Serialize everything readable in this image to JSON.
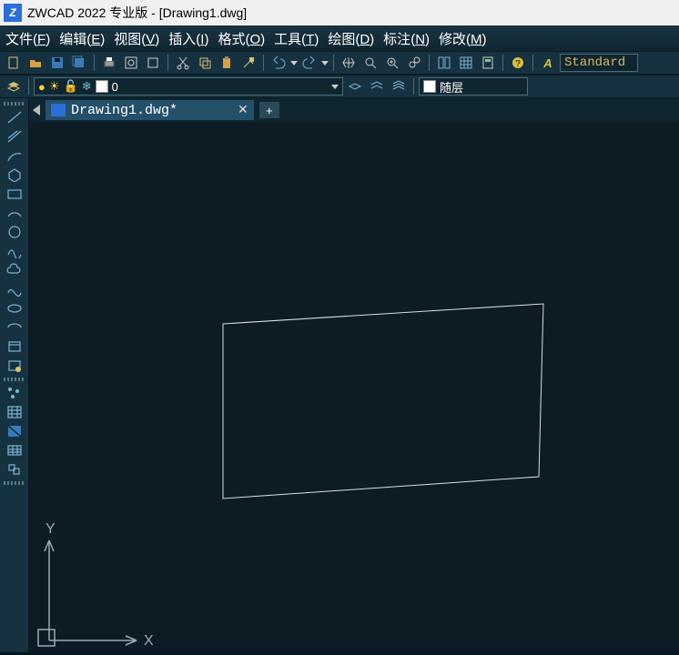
{
  "title_bar": {
    "app_glyph": "Z",
    "title": "ZWCAD 2022 专业版 - [Drawing1.dwg]"
  },
  "menu": {
    "file": {
      "label": "文件",
      "accel": "F"
    },
    "edit": {
      "label": "编辑",
      "accel": "E"
    },
    "view": {
      "label": "视图",
      "accel": "V"
    },
    "insert": {
      "label": "插入",
      "accel": "I"
    },
    "format": {
      "label": "格式",
      "accel": "O"
    },
    "tools": {
      "label": "工具",
      "accel": "T"
    },
    "draw": {
      "label": "绘图",
      "accel": "D"
    },
    "dim": {
      "label": "标注",
      "accel": "N"
    },
    "modify": {
      "label": "修改",
      "accel": "M"
    }
  },
  "toolbar1": {
    "style_label": "Standard"
  },
  "layer_bar": {
    "layer_name": "0",
    "bylayer_label": "随层"
  },
  "doc_tab": {
    "name": "Drawing1.dwg*",
    "close": "✕",
    "new": "+"
  },
  "axis": {
    "x": "X",
    "y": "Y"
  },
  "icons": {
    "new": "new-icon",
    "open": "open-icon",
    "save": "save-icon",
    "saveall": "saveall-icon",
    "print": "print-icon",
    "preview": "preview-icon",
    "plot": "plot-icon",
    "cut": "cut-icon",
    "copy": "copy-icon",
    "paste": "paste-icon",
    "match": "match-icon",
    "undo": "undo-icon",
    "redo": "redo-icon",
    "pan": "pan-icon",
    "zoom": "zoom-icon",
    "zoomwin": "zoomwin-icon",
    "zoomall": "zoomall-icon",
    "props": "props-icon",
    "table": "table-icon",
    "calc": "calc-icon",
    "help": "help-icon",
    "textstyle": "textstyle-icon",
    "layeriso": "layeriso-icon",
    "bulb": "bulb-icon",
    "sun": "sun-icon",
    "lock": "lock-icon",
    "thaw": "thaw-icon",
    "laymgr1": "laymgr1-icon",
    "laymgr2": "laymgr2-icon",
    "laymgr3": "laymgr3-icon"
  },
  "tools": {
    "items": [
      "line-tool",
      "ray-tool",
      "arc-tool",
      "polygon-tool",
      "rectangle-tool",
      "arc2-tool",
      "circle-tool",
      "spline2-tool",
      "cloud-tool",
      "spline-tool",
      "ellipse-tool",
      "ellipsearc-tool",
      "block-tool",
      "block2-tool",
      "point-tool",
      "hatch-tool",
      "gradient-tool",
      "table-tool",
      "region-tool"
    ]
  }
}
